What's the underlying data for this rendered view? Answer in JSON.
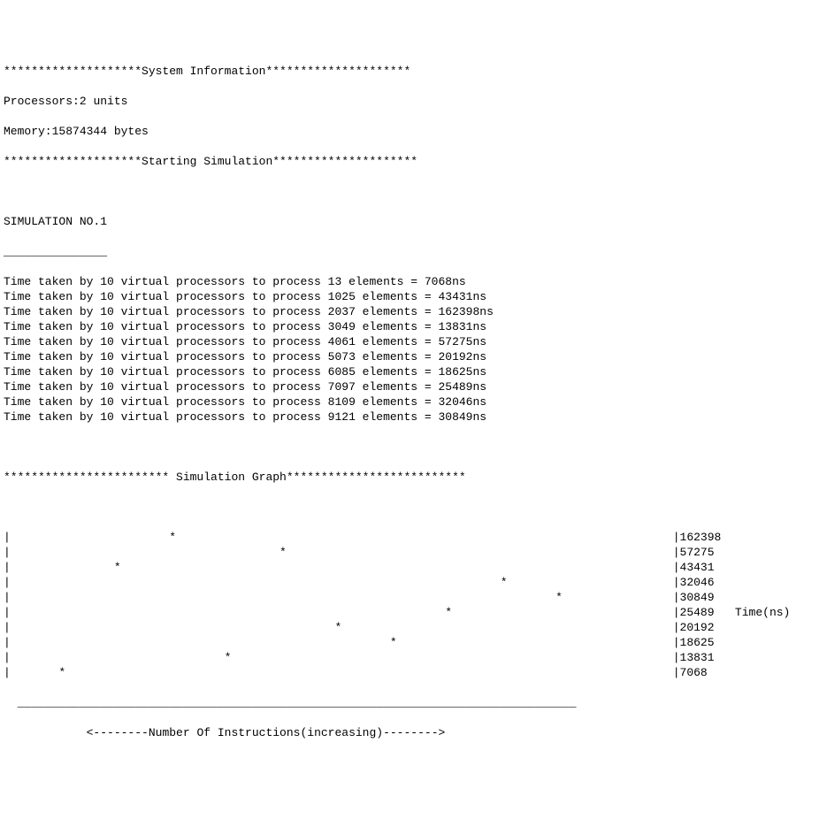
{
  "header": {
    "sysinfo_banner": "********************System Information*********************",
    "processors_label": "Processors:",
    "processors_value": "2",
    "processors_unit": " units",
    "memory_label": "Memory:",
    "memory_value": "15874344",
    "memory_unit": " bytes",
    "starting_banner": "********************Starting Simulation*********************"
  },
  "simulation": {
    "title": "SIMULATION NO.1",
    "underline": "_______________",
    "virtual_processors": 10,
    "rows": [
      {
        "elements": "13",
        "time_ns": "7068"
      },
      {
        "elements": "1025",
        "time_ns": "43431"
      },
      {
        "elements": "2037",
        "time_ns": "162398"
      },
      {
        "elements": "3049",
        "time_ns": "13831"
      },
      {
        "elements": "4061",
        "time_ns": "57275"
      },
      {
        "elements": "5073",
        "time_ns": "20192"
      },
      {
        "elements": "6085",
        "time_ns": "18625"
      },
      {
        "elements": "7097",
        "time_ns": "25489"
      },
      {
        "elements": "8109",
        "time_ns": "32046"
      },
      {
        "elements": "9121",
        "time_ns": "30849"
      }
    ]
  },
  "graph": {
    "banner": "************************ Simulation Graph**************************",
    "ylabel": "Time(ns)",
    "xlabel": "<--------Number Of Instructions(increasing)-------->",
    "chart_left_width": 97,
    "underline": "_________________________________________________________________________________",
    "underline_indent": "  ",
    "xlabel_indent": "            ",
    "points": [
      {
        "star_col": 24,
        "value": "162398"
      },
      {
        "star_col": 40,
        "value": "57275"
      },
      {
        "star_col": 16,
        "value": "43431"
      },
      {
        "star_col": 72,
        "value": "32046"
      },
      {
        "star_col": 80,
        "value": "30849"
      },
      {
        "star_col": 64,
        "value": "25489",
        "show_ylabel": true
      },
      {
        "star_col": 48,
        "value": "20192"
      },
      {
        "star_col": 56,
        "value": "18625"
      },
      {
        "star_col": 32,
        "value": "13831"
      },
      {
        "star_col": 8,
        "value": "7068"
      }
    ]
  },
  "chart_data": {
    "type": "scatter",
    "title": "Simulation Graph",
    "xlabel": "Number Of Instructions (increasing)",
    "ylabel": "Time (ns)",
    "note": "x shown as plotted column position; y is time in ns; labels at right are y values sorted descending",
    "x": [
      24,
      40,
      16,
      72,
      80,
      64,
      48,
      56,
      32,
      8
    ],
    "y": [
      162398,
      57275,
      43431,
      32046,
      30849,
      25489,
      20192,
      18625,
      13831,
      7068
    ]
  }
}
